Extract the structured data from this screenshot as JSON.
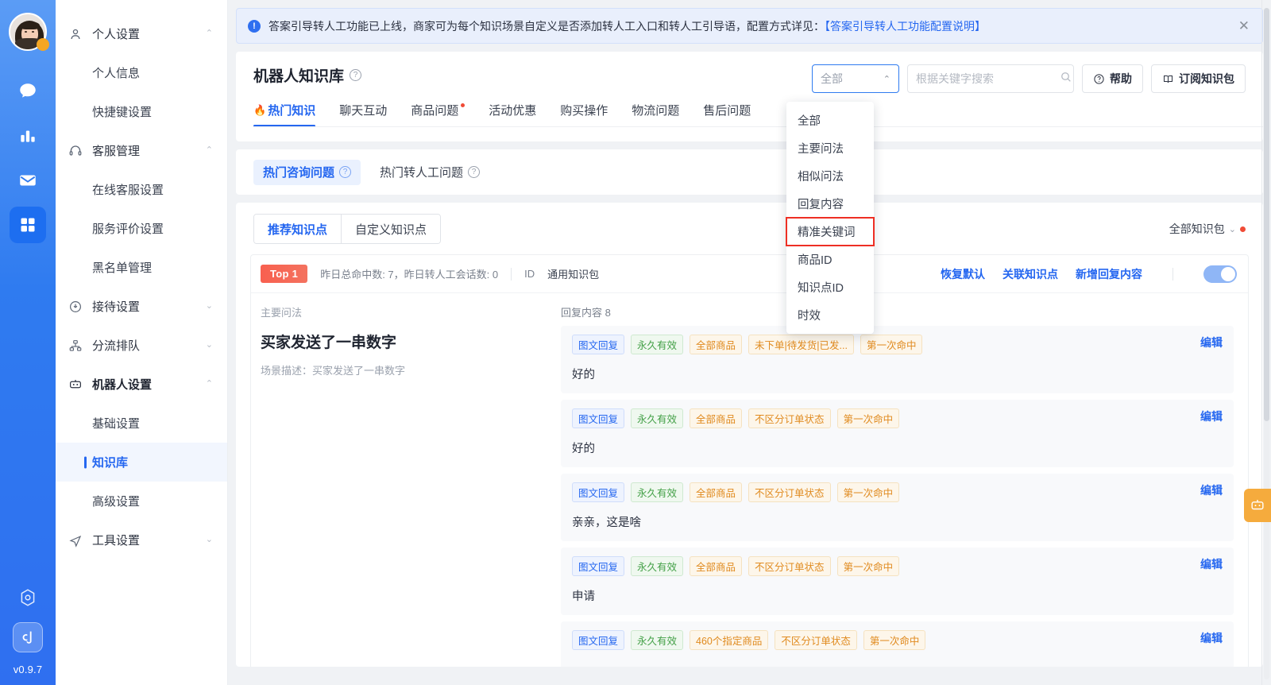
{
  "rail": {
    "avatar_name": "user-avatar",
    "items": [
      {
        "name": "chat-icon",
        "label": "聊天",
        "active": false
      },
      {
        "name": "statistics-icon",
        "label": "数据统计",
        "active": false
      },
      {
        "name": "mail-icon",
        "label": "消息",
        "active": false
      },
      {
        "name": "apps-icon",
        "label": "应用",
        "active": true
      }
    ],
    "settings_icon": "gear-icon",
    "logo_icon": "brand-logo-icon",
    "version": "v0.9.7"
  },
  "sidebar": {
    "groups": [
      {
        "icon": "user-icon",
        "label": "个人设置",
        "expanded": true,
        "caret": "⌃",
        "children": [
          {
            "label": "个人信息",
            "active": false
          },
          {
            "label": "快捷键设置",
            "active": false
          }
        ]
      },
      {
        "icon": "headset-icon",
        "label": "客服管理",
        "expanded": true,
        "caret": "⌃",
        "children": [
          {
            "label": "在线客服设置",
            "active": false
          },
          {
            "label": "服务评价设置",
            "active": false
          },
          {
            "label": "黑名单管理",
            "active": false
          }
        ]
      },
      {
        "icon": "reception-icon",
        "label": "接待设置",
        "expanded": false,
        "caret": "⌄",
        "children": []
      },
      {
        "icon": "queue-icon",
        "label": "分流排队",
        "expanded": false,
        "caret": "⌄",
        "children": []
      },
      {
        "icon": "robot-icon",
        "label": "机器人设置",
        "expanded": true,
        "caret": "⌃",
        "bold": true,
        "children": [
          {
            "label": "基础设置",
            "active": false
          },
          {
            "label": "知识库",
            "active": true
          },
          {
            "label": "高级设置",
            "active": false
          }
        ]
      },
      {
        "icon": "tools-icon",
        "label": "工具设置",
        "expanded": false,
        "caret": "⌄",
        "children": []
      }
    ]
  },
  "banner": {
    "icon": "info-icon",
    "text": "答案引导转人工功能已上线，商家可为每个知识场景自定义是否添加转人工入口和转人工引导语，配置方式详见：",
    "link": "【答案引导转人工功能配置说明】",
    "close_icon": "close-icon"
  },
  "header": {
    "title": "机器人知识库",
    "title_help_icon": "question-mark-icon",
    "filter_select": {
      "value": "全部",
      "caret_icon": "chevron-up-icon"
    },
    "search": {
      "placeholder": "根据关键字搜索",
      "value": "",
      "icon": "search-icon"
    },
    "help_button": {
      "label": "帮助",
      "icon": "question-circle-icon"
    },
    "subscribe_button": {
      "label": "订阅知识包",
      "icon": "book-icon"
    }
  },
  "dropdown": {
    "open": true,
    "items": [
      {
        "label": "全部",
        "highlighted": false
      },
      {
        "label": "主要问法",
        "highlighted": false
      },
      {
        "label": "相似问法",
        "highlighted": false
      },
      {
        "label": "回复内容",
        "highlighted": false
      },
      {
        "label": "精准关键词",
        "highlighted": true
      },
      {
        "label": "商品ID",
        "highlighted": false
      },
      {
        "label": "知识点ID",
        "highlighted": false
      },
      {
        "label": "时效",
        "highlighted": false
      }
    ]
  },
  "tabs": [
    {
      "label": "热门知识",
      "active": true,
      "fire": true,
      "dot": false
    },
    {
      "label": "聊天互动",
      "active": false,
      "fire": false,
      "dot": false
    },
    {
      "label": "商品问题",
      "active": false,
      "fire": false,
      "dot": true
    },
    {
      "label": "活动优惠",
      "active": false,
      "fire": false,
      "dot": false
    },
    {
      "label": "购买操作",
      "active": false,
      "fire": false,
      "dot": false
    },
    {
      "label": "物流问题",
      "active": false,
      "fire": false,
      "dot": false
    },
    {
      "label": "售后问题",
      "active": false,
      "fire": false,
      "dot": false
    }
  ],
  "chips": [
    {
      "label": "热门咨询问题",
      "active": true,
      "help_icon": "question-mark-icon"
    },
    {
      "label": "热门转人工问题",
      "active": false,
      "help_icon": "question-mark-icon"
    }
  ],
  "content": {
    "segments": [
      {
        "label": "推荐知识点",
        "active": true
      },
      {
        "label": "自定义知识点",
        "active": false
      }
    ],
    "pack_select": {
      "label": "全部知识包",
      "caret_icon": "chevron-down-icon",
      "dot": true
    },
    "card": {
      "rank_badge": "Top 1",
      "stats": "昨日总命中数: 7，昨日转人工会话数: 0",
      "id_label": "ID",
      "pack_name": "通用知识包",
      "actions": [
        "恢复默认",
        "关联知识点",
        "新增回复内容"
      ],
      "toggle_on": true,
      "question_label": "主要问法",
      "question": "买家发送了一串数字",
      "description": "场景描述：买家发送了一串数字",
      "reply_count_label": "回复内容 8",
      "edit_label": "编辑",
      "replies": [
        {
          "tags": [
            {
              "text": "图文回复",
              "color": "blue"
            },
            {
              "text": "永久有效",
              "color": "green"
            },
            {
              "text": "全部商品",
              "color": "orange"
            },
            {
              "text": "未下单|待发货|已发...",
              "color": "orange"
            },
            {
              "text": "第一次命中",
              "color": "orange"
            }
          ],
          "text": "好的"
        },
        {
          "tags": [
            {
              "text": "图文回复",
              "color": "blue"
            },
            {
              "text": "永久有效",
              "color": "green"
            },
            {
              "text": "全部商品",
              "color": "orange"
            },
            {
              "text": "不区分订单状态",
              "color": "orange"
            },
            {
              "text": "第一次命中",
              "color": "orange"
            }
          ],
          "text": "好的"
        },
        {
          "tags": [
            {
              "text": "图文回复",
              "color": "blue"
            },
            {
              "text": "永久有效",
              "color": "green"
            },
            {
              "text": "全部商品",
              "color": "orange"
            },
            {
              "text": "不区分订单状态",
              "color": "orange"
            },
            {
              "text": "第一次命中",
              "color": "orange"
            }
          ],
          "text": "亲亲，这是啥"
        },
        {
          "tags": [
            {
              "text": "图文回复",
              "color": "blue"
            },
            {
              "text": "永久有效",
              "color": "green"
            },
            {
              "text": "全部商品",
              "color": "orange"
            },
            {
              "text": "不区分订单状态",
              "color": "orange"
            },
            {
              "text": "第一次命中",
              "color": "orange"
            }
          ],
          "text": "申请"
        },
        {
          "tags": [
            {
              "text": "图文回复",
              "color": "blue"
            },
            {
              "text": "永久有效",
              "color": "green"
            },
            {
              "text": "460个指定商品",
              "color": "orange"
            },
            {
              "text": "不区分订单状态",
              "color": "orange"
            },
            {
              "text": "第一次命中",
              "color": "orange"
            }
          ],
          "text": ""
        }
      ]
    }
  },
  "floater": {
    "icon": "robot-assistant-icon"
  },
  "colors": {
    "brand_blue": "#2567f0",
    "rail_blue": "#2f7bf0",
    "accent_red": "#f04b36",
    "badge_orange": "#f5a623",
    "floater_orange": "#f5ab3d",
    "highlight_red": "#ee2f24"
  }
}
